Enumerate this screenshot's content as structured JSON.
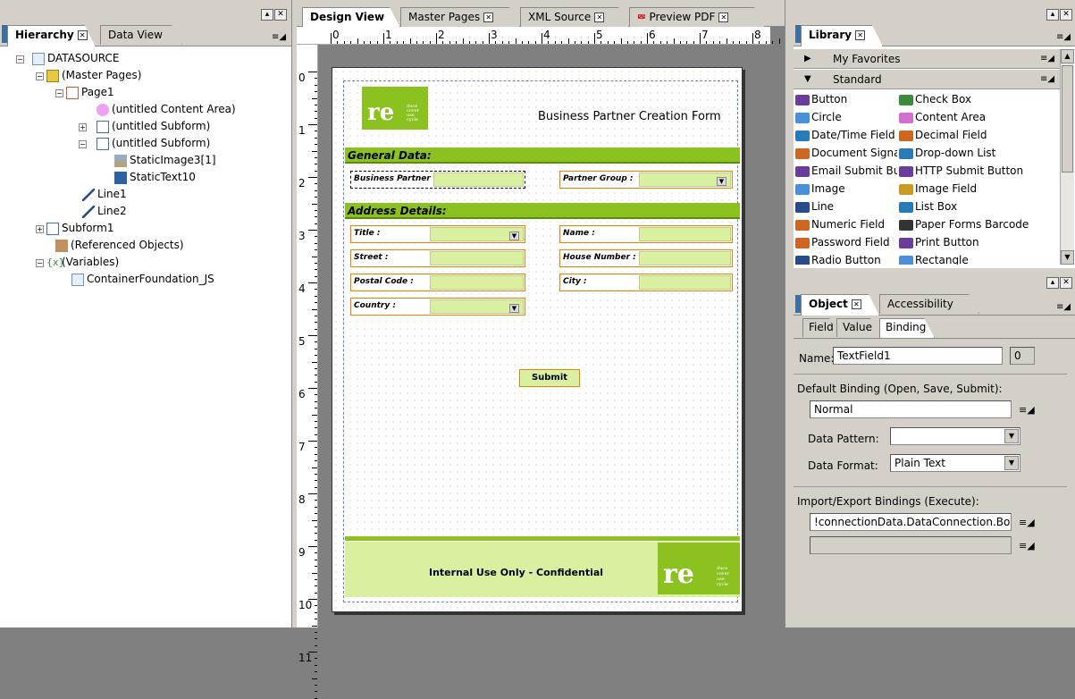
{
  "hierarchy_panel": {
    "tabs": [
      {
        "label": "Hierarchy"
      },
      {
        "label": "Data View"
      }
    ],
    "tree": [
      {
        "label": "DATASOURCE"
      },
      {
        "label": "(Master Pages)"
      },
      {
        "label": "Page1"
      },
      {
        "label": "(untitled Content Area)"
      },
      {
        "label": "(untitled Subform)"
      },
      {
        "label": "(untitled Subform)"
      },
      {
        "label": "StaticImage3[1]"
      },
      {
        "label": "StaticText10"
      },
      {
        "label": "Line1"
      },
      {
        "label": "Line2"
      },
      {
        "label": "Subform1"
      },
      {
        "label": "(Referenced Objects)"
      },
      {
        "label": "(Variables)"
      },
      {
        "label": "ContainerFoundation_JS"
      }
    ]
  },
  "editor": {
    "tabs": [
      {
        "label": "Design View"
      },
      {
        "label": "Master Pages"
      },
      {
        "label": "XML Source"
      },
      {
        "label": "Preview PDF"
      }
    ],
    "ruler_h": [
      "0",
      "1",
      "2",
      "3",
      "4",
      "5",
      "6",
      "7",
      "8"
    ],
    "ruler_v": [
      "0",
      "1",
      "2",
      "3",
      "4",
      "5",
      "6",
      "7",
      "8",
      "9",
      "10",
      "11"
    ]
  },
  "form": {
    "title": "Business Partner Creation Form",
    "logo_text": "re",
    "logo_small": [
      "duce",
      "cover",
      "use",
      "cycle"
    ],
    "general_header": "General Data:",
    "address_header": "Address Details:",
    "fields": {
      "business_partner": "Business Partner :",
      "partner_group": "Partner Group :",
      "title": "Title :",
      "name": "Name :",
      "street": "Street :",
      "house_number": "House Number :",
      "postal_code": "Postal Code :",
      "city": "City :",
      "country": "Country :"
    },
    "submit": "Submit",
    "footer": "Internal Use Only - Confidential"
  },
  "library": {
    "tab": "Library",
    "groups": {
      "favorites": "My Favorites",
      "standard": "Standard"
    },
    "items": [
      {
        "label": "Button",
        "color": "#6a3d9a"
      },
      {
        "label": "Check Box",
        "color": "#3c8a3c"
      },
      {
        "label": "Circle",
        "color": "#4a90d9"
      },
      {
        "label": "Content Area",
        "color": "#d070d0"
      },
      {
        "label": "Date/Time Field",
        "color": "#2a7ab8"
      },
      {
        "label": "Decimal Field",
        "color": "#cc6622"
      },
      {
        "label": "Document Signa",
        "color": "#cc6622"
      },
      {
        "label": "Drop-down List",
        "color": "#2a7ab8"
      },
      {
        "label": "Email Submit But",
        "color": "#6a3d9a"
      },
      {
        "label": "HTTP Submit Button",
        "color": "#6a3d9a"
      },
      {
        "label": "Image",
        "color": "#4a90d9"
      },
      {
        "label": "Image Field",
        "color": "#cc9922"
      },
      {
        "label": "Line",
        "color": "#2a4a8a"
      },
      {
        "label": "List Box",
        "color": "#2a7ab8"
      },
      {
        "label": "Numeric Field",
        "color": "#cc6622"
      },
      {
        "label": "Paper Forms Barcode",
        "color": "#333333"
      },
      {
        "label": "Password Field",
        "color": "#cc6622"
      },
      {
        "label": "Print Button",
        "color": "#6a3d9a"
      },
      {
        "label": "Radio Button",
        "color": "#2a4a8a"
      },
      {
        "label": "Rectangle",
        "color": "#4a90d9"
      }
    ]
  },
  "object_panel": {
    "tabs": [
      {
        "label": "Object"
      },
      {
        "label": "Accessibility"
      }
    ],
    "subtabs": [
      {
        "label": "Field"
      },
      {
        "label": "Value"
      },
      {
        "label": "Binding"
      }
    ],
    "name_label": "Name:",
    "name_value": "TextField1",
    "index_value": "0",
    "default_binding_label": "Default Binding (Open, Save, Submit):",
    "default_binding_value": "Normal",
    "data_pattern_label": "Data Pattern:",
    "data_pattern_value": "",
    "data_format_label": "Data Format:",
    "data_format_value": "Plain Text",
    "import_export_label": "Import/Export Bindings (Execute):",
    "import_export_value": "!connectionData.DataConnection.Bo",
    "import_export_value2": ""
  },
  "colors": {
    "accent_green": "#8cc220",
    "field_orange": "#f08000"
  }
}
